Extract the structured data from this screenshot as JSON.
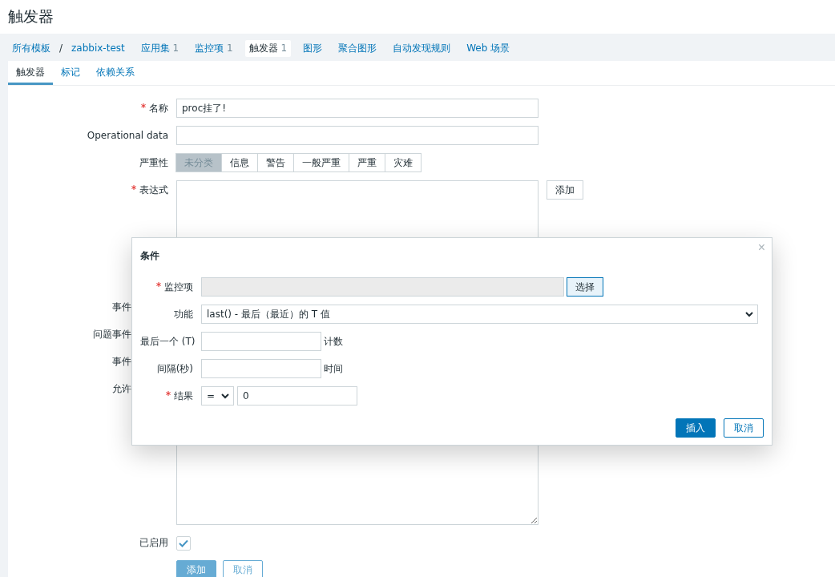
{
  "page_title": "触发器",
  "breadcrumbs": [
    {
      "label": "所有模板",
      "selected": false
    },
    {
      "label": "zabbix-test",
      "selected": false
    },
    {
      "label": "应用集",
      "count": "1",
      "selected": false
    },
    {
      "label": "监控项",
      "count": "1",
      "selected": false
    },
    {
      "label": "触发器",
      "count": "1",
      "selected": true
    },
    {
      "label": "图形",
      "selected": false
    },
    {
      "label": "聚合图形",
      "selected": false
    },
    {
      "label": "自动发现规则",
      "selected": false
    },
    {
      "label": "Web 场景",
      "selected": false
    }
  ],
  "breadcrumb_separator": "/",
  "tabs": [
    {
      "label": "触发器",
      "selected": true
    },
    {
      "label": "标记",
      "selected": false
    },
    {
      "label": "依赖关系",
      "selected": false
    }
  ],
  "form": {
    "name": {
      "label": "名称",
      "required": true,
      "value": "proc挂了!"
    },
    "operational_data": {
      "label": "Operational data"
    },
    "severity": {
      "label": "严重性",
      "options": [
        {
          "label": "未分类",
          "selected": true
        },
        {
          "label": "信息",
          "selected": false
        },
        {
          "label": "警告",
          "selected": false
        },
        {
          "label": "一般严重",
          "selected": false
        },
        {
          "label": "严重",
          "selected": false
        },
        {
          "label": "灾难",
          "selected": false
        }
      ]
    },
    "expression": {
      "label": "表达式",
      "required": true,
      "add_button": "添加"
    },
    "covered_labels": [
      "事件",
      "问题事件",
      "事件",
      "允许"
    ],
    "enabled": {
      "label": "已启用",
      "checked": true
    },
    "buttons": [
      {
        "label": "添加",
        "kind": "primary"
      },
      {
        "label": "取消",
        "kind": "secondary"
      }
    ]
  },
  "dialog": {
    "title": "条件",
    "close": "×",
    "item": {
      "label": "监控项",
      "required": true,
      "button": "选择"
    },
    "function": {
      "label": "功能",
      "value": "last() - 最后（最近）的 T 值"
    },
    "last_t": {
      "label": "最后一个 (T)",
      "unit": "计数"
    },
    "interval": {
      "label": "间隔(秒)",
      "unit": "时间"
    },
    "result": {
      "label": "结果",
      "required": true,
      "operator": "=",
      "value": "0"
    },
    "buttons": [
      {
        "label": "插入",
        "kind": "primary"
      },
      {
        "label": "取消",
        "kind": "secondary"
      }
    ]
  }
}
